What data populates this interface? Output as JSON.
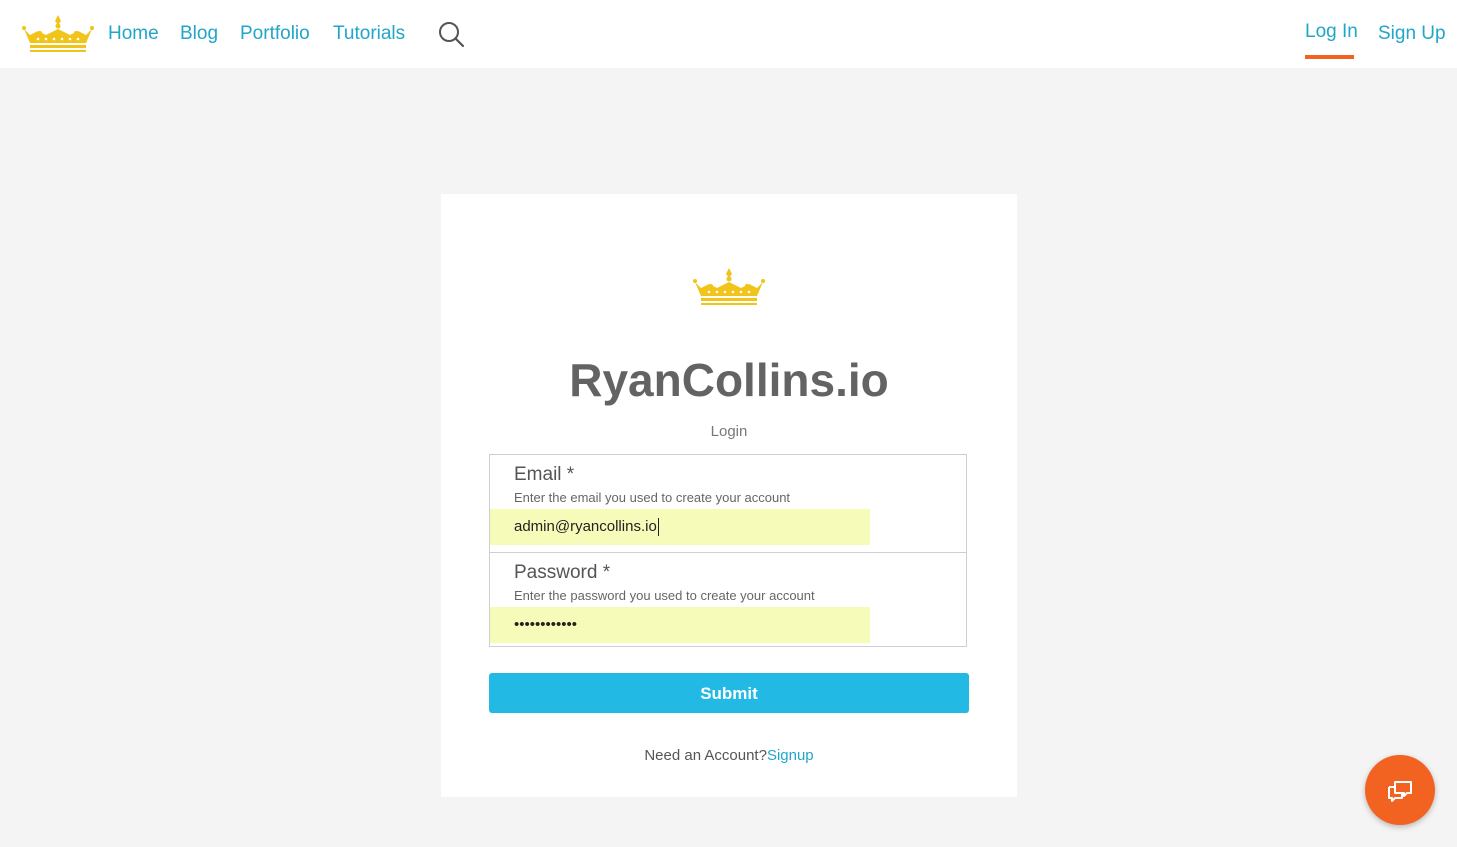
{
  "header": {
    "nav": [
      "Home",
      "Blog",
      "Portfolio",
      "Tutorials"
    ],
    "login": "Log In",
    "signup": "Sign Up"
  },
  "card": {
    "title": "RyanCollins.io",
    "subtitle": "Login",
    "email": {
      "label": "Email *",
      "help": "Enter the email you used to create your account",
      "value": "admin@ryancollins.io"
    },
    "password": {
      "label": "Password *",
      "help": "Enter the password you used to create your account",
      "value": "••••••••••••"
    },
    "submit": "Submit",
    "need_account": "Need an Account?",
    "signup_link": "Signup"
  },
  "colors": {
    "accent": "#21a6c9",
    "button": "#22bae4",
    "active_underline": "#f26322",
    "logo": "#f0c419",
    "autofill": "#f7fbb9"
  },
  "icons": {
    "logo": "crown-icon",
    "search": "search-icon",
    "chat": "chat-icon"
  }
}
